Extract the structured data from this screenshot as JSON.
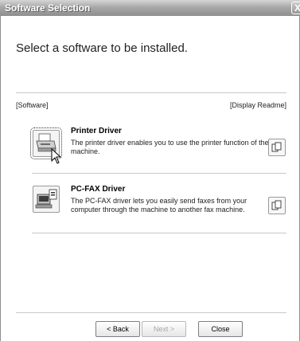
{
  "window": {
    "title": "Software Selection",
    "close_glyph": "X"
  },
  "heading": "Select a software to be installed.",
  "list_header": {
    "left": "[Software]",
    "right": "[Display Readme]"
  },
  "items": [
    {
      "title": "Printer Driver",
      "desc_line1": "The printer driver enables you to use the printer function of the",
      "desc_line2": "machine.",
      "icon": "printer-icon",
      "readme_icon": "readme-document-icon"
    },
    {
      "title": "PC-FAX Driver",
      "desc_line1": "The PC-FAX driver lets you easily send faxes from your",
      "desc_line2": "computer through the machine to another fax machine.",
      "icon": "pc-fax-icon",
      "readme_icon": "readme-document-icon"
    }
  ],
  "footer": {
    "back_label": "< Back",
    "next_label": "Next >",
    "close_label": "Close"
  }
}
